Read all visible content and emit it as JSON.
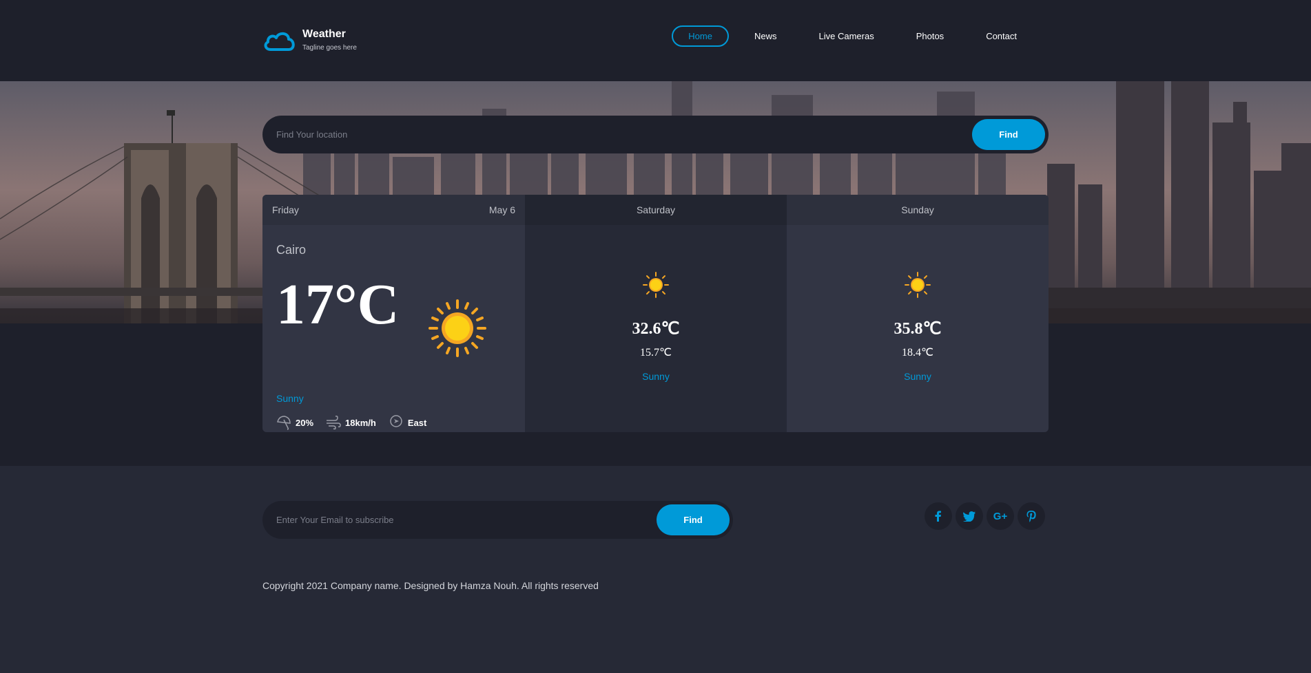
{
  "brand": {
    "title": "Weather",
    "tagline": "Tagline goes here"
  },
  "nav": {
    "items": [
      "Home",
      "News",
      "Live Cameras",
      "Photos",
      "Contact"
    ],
    "active": "Home"
  },
  "search": {
    "placeholder": "Find Your location",
    "button": "Find"
  },
  "today": {
    "day": "Friday",
    "date": "May 6",
    "city": "Cairo",
    "temp": "17°C",
    "condition": "Sunny",
    "rain": "20%",
    "wind": "18km/h",
    "direction": "East",
    "icon": "sun-icon"
  },
  "forecast": [
    {
      "day": "Saturday",
      "max": "32.6℃",
      "min": "15.7℃",
      "condition": "Sunny",
      "icon": "sun-icon"
    },
    {
      "day": "Sunday",
      "max": "35.8℃",
      "min": "18.4℃",
      "condition": "Sunny",
      "icon": "sun-icon"
    }
  ],
  "subscribe": {
    "placeholder": "Enter Your Email to subscribe",
    "button": "Find"
  },
  "socials": [
    "facebook-icon",
    "twitter-icon",
    "google-plus-icon",
    "pinterest-icon"
  ],
  "footer": {
    "copyright": "Copyright 2021 Company name. Designed by Hamza Nouh. All rights reserved"
  },
  "colors": {
    "accent": "#009ad8",
    "background": "#1e202b",
    "panel": "#323544",
    "sun": "#fbc02d"
  }
}
